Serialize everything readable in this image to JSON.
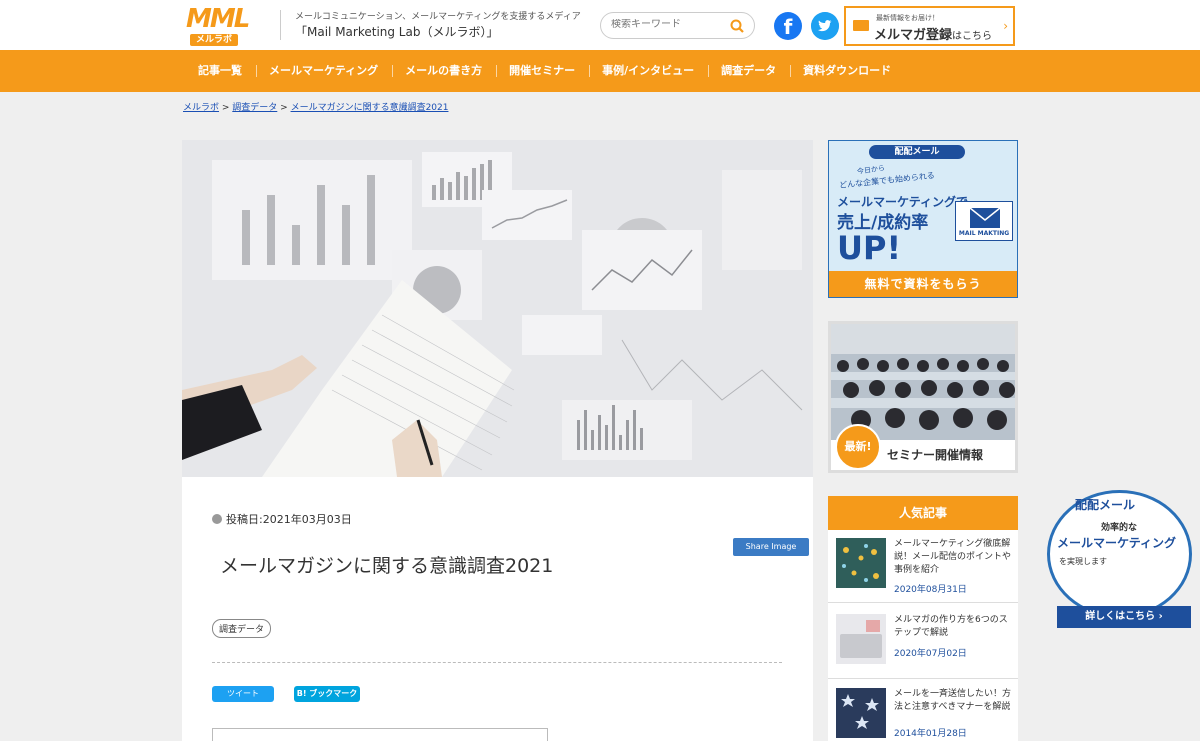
{
  "header": {
    "logo_mark": "MML",
    "logo_sub": "メルラボ",
    "tagline_line1": "メールコミュニケーション、メールマーケティングを支援するメディア",
    "tagline_line2": "「Mail Marketing Lab（メルラボ）」",
    "search_placeholder": "検索キーワード",
    "facebook_glyph": "f",
    "newsletter_small": "最新情報をお届け！",
    "newsletter_main": "メルマガ登録",
    "newsletter_suffix": "はこちら",
    "newsletter_arrow": "›"
  },
  "nav": {
    "items": [
      "記事一覧",
      "メールマーケティング",
      "メールの書き方",
      "開催セミナー",
      "事例/インタビュー",
      "調査データ",
      "資料ダウンロード"
    ]
  },
  "breadcrumb": {
    "home": "メルラボ",
    "sep": " > ",
    "category": "調査データ",
    "current": "メールマガジンに関する意識調査2021"
  },
  "article": {
    "posted_label": "投稿日:2021年03月03日",
    "share_image": "Share Image",
    "title": "メールマガジンに関する意識調査2021",
    "tag": "調査データ",
    "tweet": "ツイート",
    "bookmark": "B! ブックマーク"
  },
  "sidebar": {
    "ad1": {
      "brand": "配配メール",
      "line1": "今日から",
      "line2": "どんな企業でも始められる",
      "line3": "メールマーケティングで",
      "line4": "売上/成約率",
      "line5": "UP!",
      "envelope_label": "MAIL MAKTING",
      "cta": "無料で資料をもらう"
    },
    "ad2": {
      "badge": "最新!",
      "label": "セミナー開催情報"
    },
    "popular": {
      "heading": "人気記事",
      "items": [
        {
          "title": "メールマーケティング徹底解説！メール配信のポイントや事例を紹介",
          "date": "2020年08月31日"
        },
        {
          "title": "メルマガの作り方を6つのステップで解説",
          "date": "2020年07月02日"
        },
        {
          "title": "メールを一斉送信したい！方法と注意すべきマナーを解説",
          "date": "2014年01月28日"
        }
      ]
    }
  },
  "float_ad": {
    "brand": "配配メール",
    "line1": "効率的な",
    "line2": "メールマーケティング",
    "line3": "を実現します",
    "cta": "詳しくはこちら ›"
  },
  "colors": {
    "accent": "#f59a1a",
    "brand_blue": "#1e4f9c",
    "facebook": "#1877f2",
    "twitter": "#1da1f2"
  }
}
